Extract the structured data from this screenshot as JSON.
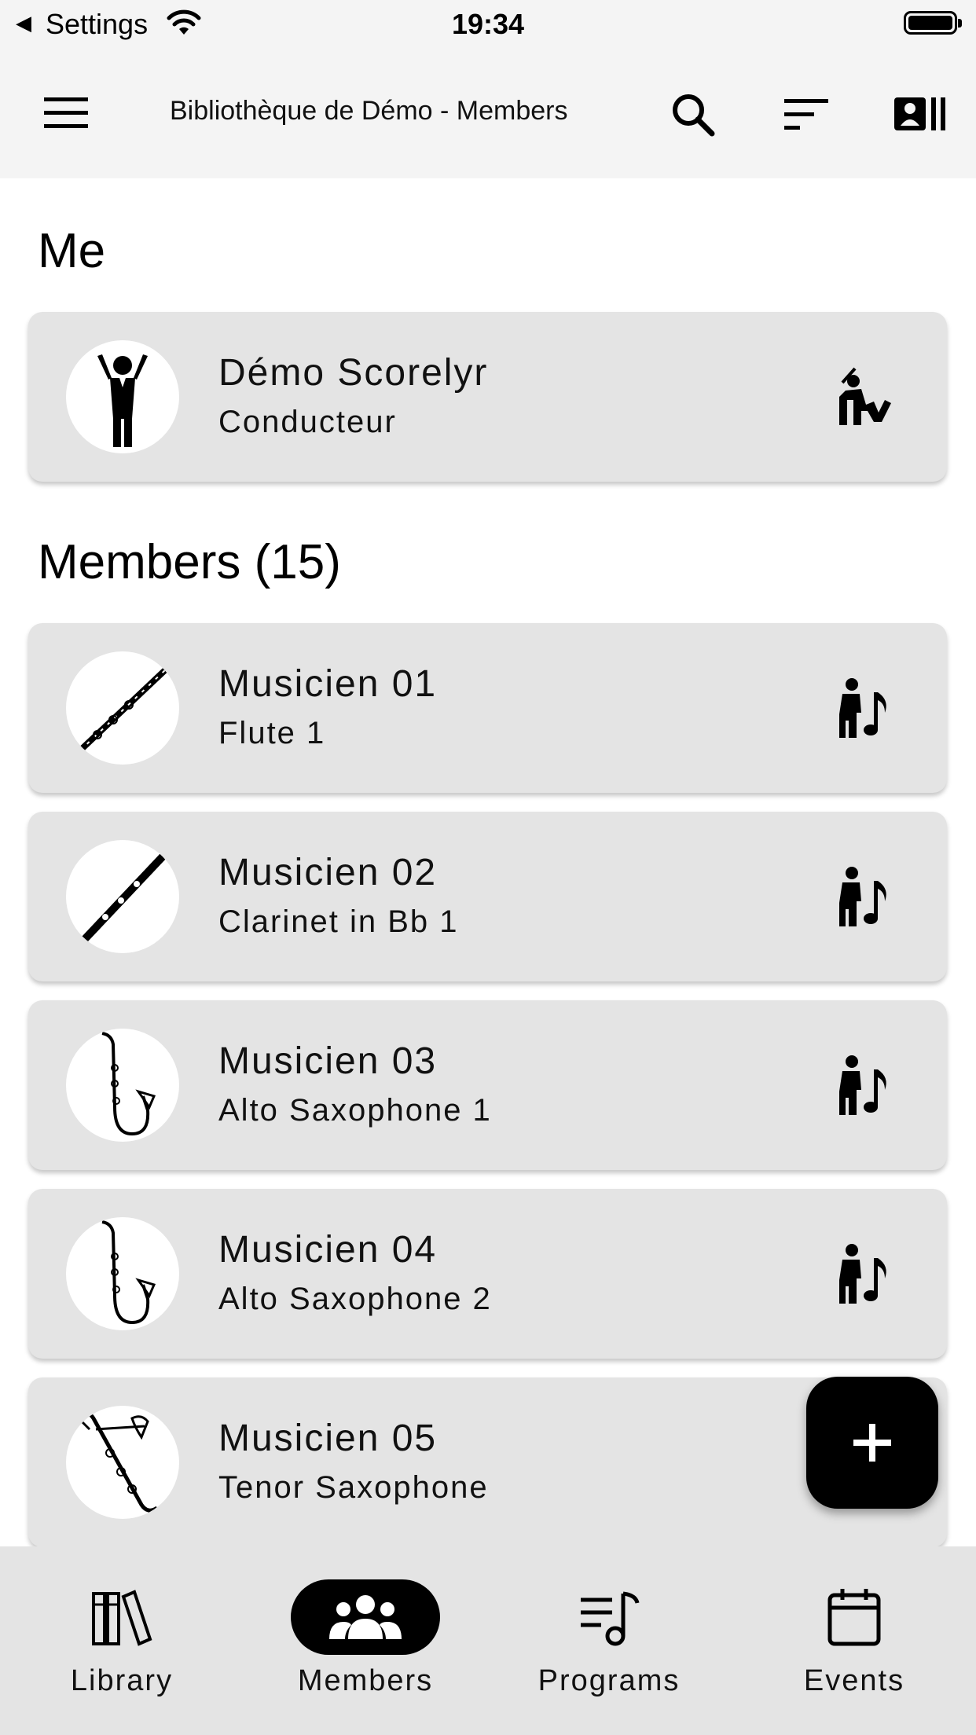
{
  "status_bar": {
    "back_label": "Settings",
    "time": "19:34"
  },
  "app_bar": {
    "title": "Bibliothèque de Démo - Members"
  },
  "me_section": {
    "title": "Me",
    "card": {
      "name": "Démo Scorelyr",
      "role": "Conducteur",
      "avatar": "conductor-avatar",
      "action_icon": "conductor-icon"
    }
  },
  "members_section": {
    "title": "Members (15)",
    "items": [
      {
        "name": "Musicien 01",
        "instrument": "Flute 1",
        "avatar": "flute-avatar",
        "action_icon": "musician-icon"
      },
      {
        "name": "Musicien 02",
        "instrument": "Clarinet in Bb 1",
        "avatar": "clarinet-avatar",
        "action_icon": "musician-icon"
      },
      {
        "name": "Musicien 03",
        "instrument": "Alto Saxophone 1",
        "avatar": "saxophone-avatar",
        "action_icon": "musician-icon"
      },
      {
        "name": "Musicien 04",
        "instrument": "Alto Saxophone 2",
        "avatar": "saxophone-avatar",
        "action_icon": "musician-icon"
      },
      {
        "name": "Musicien 05",
        "instrument": "Tenor Saxophone",
        "avatar": "tenor-saxophone-avatar",
        "action_icon": "musician-icon"
      }
    ]
  },
  "fab": {
    "icon": "plus-icon"
  },
  "bottom_nav": {
    "items": [
      {
        "label": "Library",
        "icon": "library-icon",
        "active": false
      },
      {
        "label": "Members",
        "icon": "members-icon",
        "active": true
      },
      {
        "label": "Programs",
        "icon": "programs-icon",
        "active": false
      },
      {
        "label": "Events",
        "icon": "events-icon",
        "active": false
      }
    ]
  },
  "colors": {
    "bar_bg": "#f4f4f4",
    "card_bg": "#e4e4e4",
    "accent": "#000000"
  }
}
